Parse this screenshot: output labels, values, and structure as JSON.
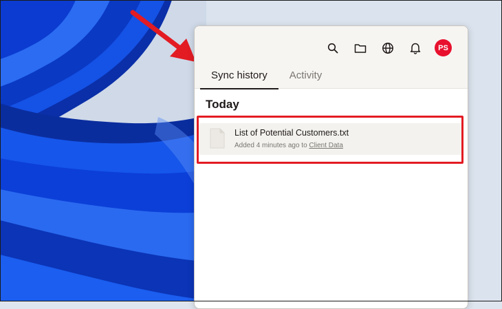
{
  "colors": {
    "accent_red": "#e31b23",
    "avatar_bg": "#e8102e",
    "wallpaper_blue": "#0b3fd6",
    "panel_header_bg": "#f7f5f2"
  },
  "header": {
    "icons": [
      "search-icon",
      "folder-icon",
      "globe-icon",
      "bell-icon"
    ],
    "avatar_initials": "PS"
  },
  "tabs": [
    {
      "label": "Sync history",
      "active": true
    },
    {
      "label": "Activity",
      "active": false
    }
  ],
  "section": {
    "title": "Today"
  },
  "file": {
    "name": "List of Potential Customers.txt",
    "meta_prefix": "Added 4 minutes ago to ",
    "folder": "Client Data",
    "icon": "text-file-icon"
  },
  "annotations": {
    "arrow_icon": "red-arrow-icon",
    "highlight": "red-highlight-box"
  }
}
